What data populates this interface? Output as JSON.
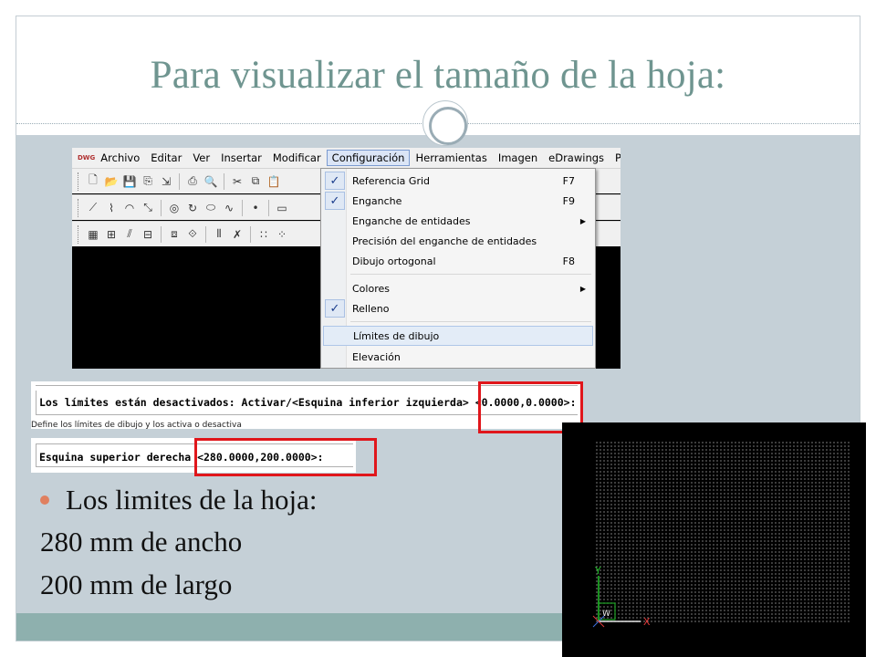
{
  "slide": {
    "title": "Para visualizar el tamaño de la hoja:",
    "bullet": "Los limites de la hoja:",
    "lines": [
      "280 mm de ancho",
      "200 mm de largo"
    ]
  },
  "app": {
    "logo_text": "DWG",
    "menu": [
      "Archivo",
      "Editar",
      "Ver",
      "Insertar",
      "Modificar",
      "Configuración",
      "Herramientas",
      "Imagen",
      "eDrawings",
      "PDM"
    ],
    "active_menu": "Configuración",
    "dropdown": [
      {
        "label": "Referencia Grid",
        "shortcut": "F7",
        "checked": true
      },
      {
        "label": "Enganche",
        "shortcut": "F9",
        "checked": true
      },
      {
        "label": "Enganche de entidades",
        "submenu": true
      },
      {
        "label": "Precisión del enganche de entidades"
      },
      {
        "label": "Dibujo ortogonal",
        "shortcut": "F8"
      },
      {
        "label": "Colores",
        "submenu": true
      },
      {
        "label": "Relleno",
        "checked": true
      },
      {
        "label": "Límites de dibujo",
        "highlighted": true
      },
      {
        "label": "Elevación"
      }
    ]
  },
  "command": {
    "line1": "Los límites están desactivados: Activar/<Esquina inferior izquierda> <0.0000,0.0000>:",
    "status": "Define los límites de dibujo y los activa o desactiva",
    "line2": "Esquina superior derecha <280.0000,200.0000>:"
  },
  "canvas": {
    "axis_y": "Y",
    "axis_x": "X",
    "axis_w": "W"
  },
  "colors": {
    "title": "#6f9590",
    "highlight_box": "#e0161b",
    "content_bg": "#c5d0d7",
    "footer": "#8eb0ae"
  }
}
